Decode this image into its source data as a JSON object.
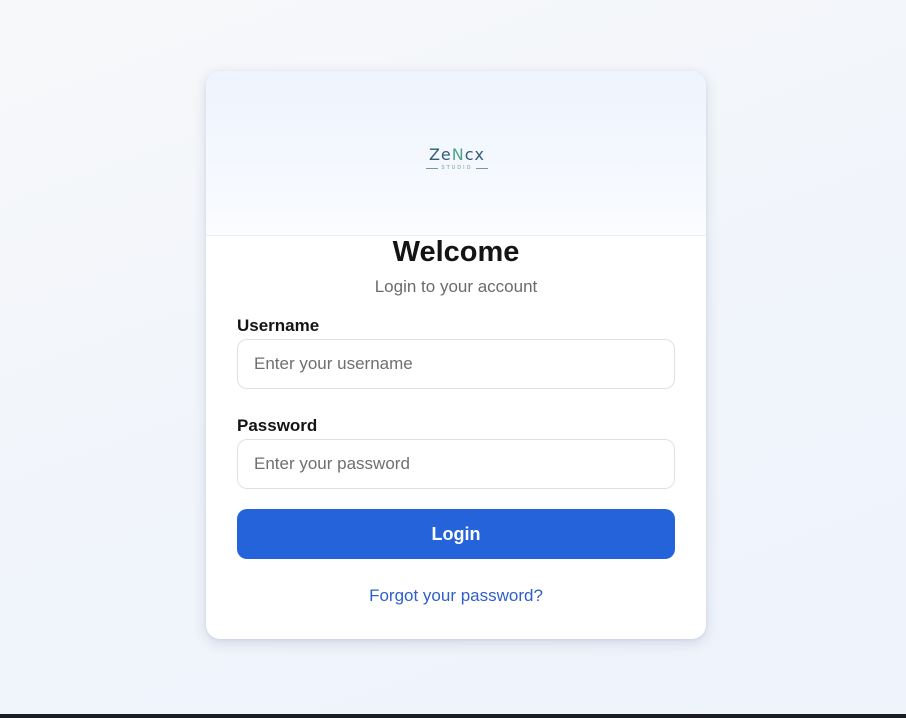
{
  "logo": {
    "word_part1": "Ze",
    "word_part2": "N",
    "word_part3": "cx",
    "sub": "STUDIO"
  },
  "login": {
    "title": "Welcome",
    "subtitle": "Login to your account",
    "username_label": "Username",
    "username_placeholder": "Enter your username",
    "username_value": "",
    "password_label": "Password",
    "password_placeholder": "Enter your password",
    "password_value": "",
    "submit_label": "Login",
    "forgot_label": "Forgot your password?"
  },
  "colors": {
    "primary": "#2563db",
    "link": "#2f5fc9",
    "logo_main": "#2f5b78",
    "logo_accent": "#4aa58a"
  }
}
